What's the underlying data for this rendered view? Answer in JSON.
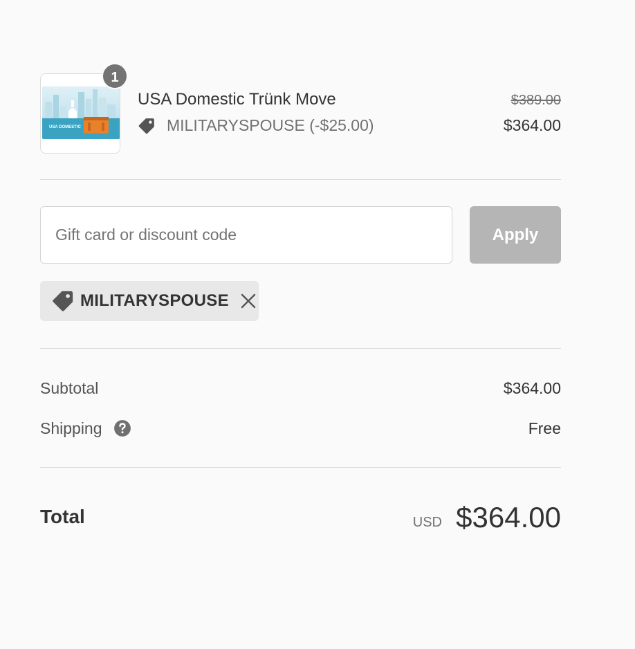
{
  "line_item": {
    "quantity": "1",
    "name": "USA Domestic Trünk Move",
    "discount_label": "MILITARYSPOUSE (-$25.00)",
    "original_price": "$389.00",
    "final_price": "$364.00",
    "thumbnail_caption": "USA DOMESTIC",
    "thumbnail_icon": "city-skyline-trunk-image"
  },
  "discount_form": {
    "placeholder": "Gift card or discount code",
    "apply_label": "Apply"
  },
  "applied_discount": {
    "code": "MILITARYSPOUSE",
    "tag_icon": "tag-icon",
    "remove_icon": "close-icon"
  },
  "totals": {
    "subtotal_label": "Subtotal",
    "subtotal_value": "$364.00",
    "shipping_label": "Shipping",
    "shipping_value": "Free",
    "total_label": "Total",
    "currency": "USD",
    "total_value": "$364.00"
  },
  "colors": {
    "background": "#fafafa",
    "apply_button": "#b5b5b5",
    "badge": "#737373",
    "applied_tag_bg": "#e8e8e8"
  }
}
